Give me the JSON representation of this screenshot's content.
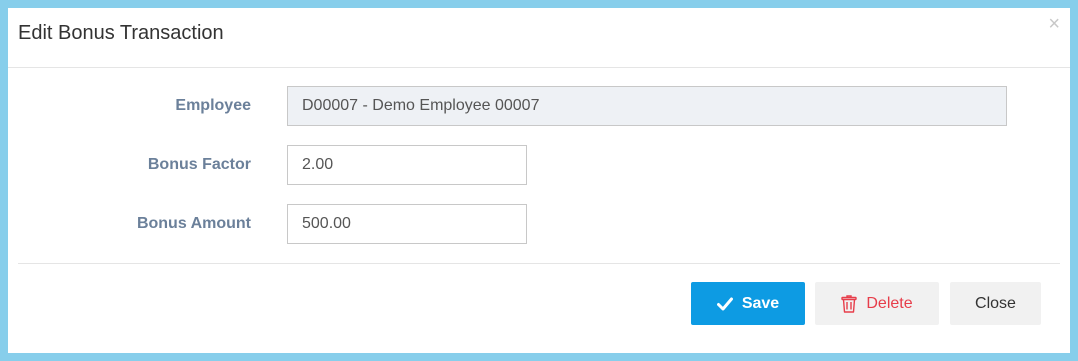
{
  "modal": {
    "title": "Edit Bonus Transaction",
    "close_glyph": "×"
  },
  "form": {
    "employee": {
      "label": "Employee",
      "value": "D00007 - Demo Employee 00007"
    },
    "bonus_factor": {
      "label": "Bonus Factor",
      "value": "2.00"
    },
    "bonus_amount": {
      "label": "Bonus Amount",
      "value": "500.00"
    }
  },
  "footer": {
    "save_label": "Save",
    "save_icon": "check-icon",
    "delete_label": "Delete",
    "delete_icon": "trash-icon",
    "close_label": "Close"
  },
  "colors": {
    "frame": "#87ceeb",
    "label": "#6b809a",
    "save_bg": "#0d9be3",
    "delete_text": "#e73d4a",
    "readonly_bg": "#eef1f5"
  }
}
